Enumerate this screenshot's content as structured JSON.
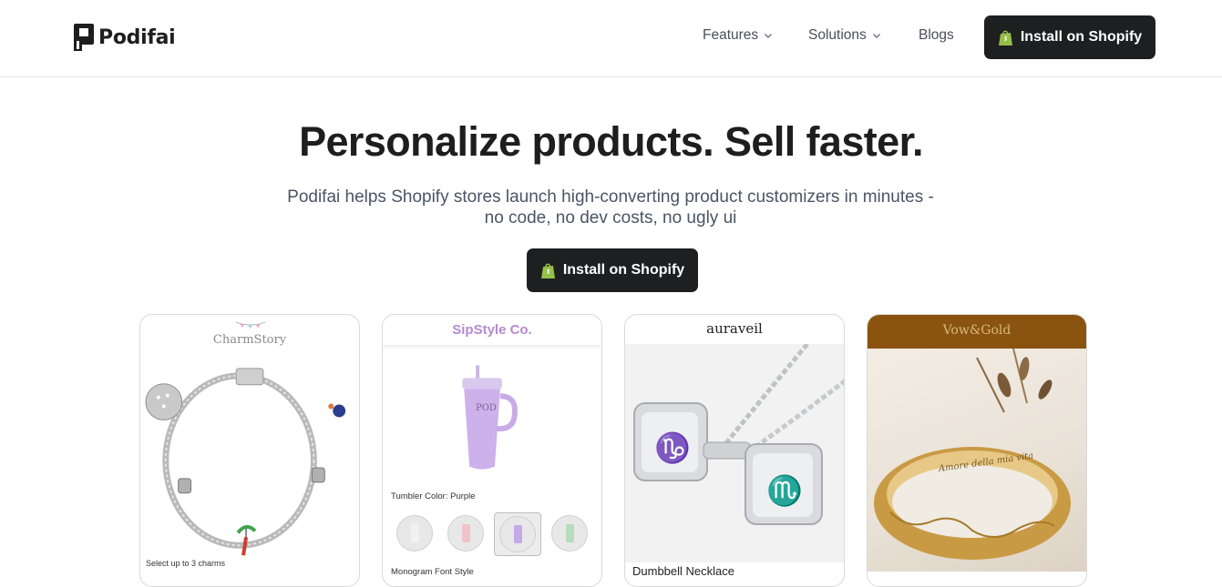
{
  "brand": {
    "name": "Podifai"
  },
  "nav": {
    "features": "Features",
    "solutions": "Solutions",
    "blogs": "Blogs",
    "install_label": "Install on Shopify"
  },
  "hero": {
    "title": "Personalize products. Sell faster.",
    "subtitle_line1": "Podifai helps Shopify stores launch high-converting product customizers in minutes -",
    "subtitle_line2": "no code, no dev costs, no ugly ui",
    "cta_label": "Install on Shopify"
  },
  "cards": [
    {
      "brand": "CharmStory",
      "caption": "Select up to 3 charms"
    },
    {
      "brand": "SipStyle Co.",
      "option_label": "Tumbler Color: Purple",
      "mug_text": "POD",
      "next_label": "Monogram Font Style"
    },
    {
      "brand": "auraveil",
      "product_title": "Dumbbell Necklace"
    },
    {
      "brand": "Vow&Gold",
      "engraving": "Amore della mia vita"
    }
  ],
  "colors": {
    "accent_dark": "#1e1f21",
    "shopify_green": "#95bf47",
    "sip_purple": "#b58ad0",
    "vow_brown": "#8a5410"
  }
}
